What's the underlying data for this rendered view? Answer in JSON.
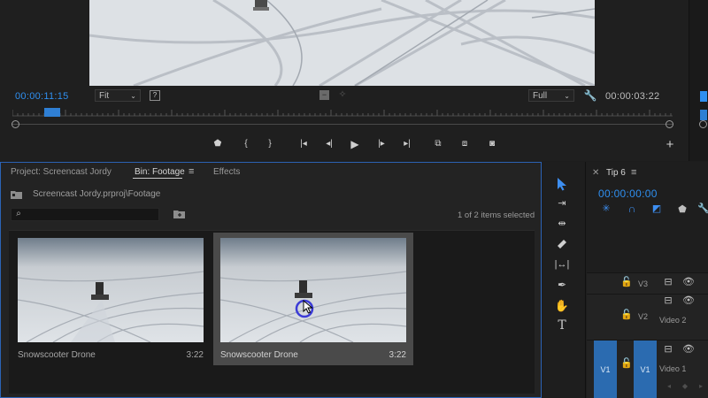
{
  "program_monitor": {
    "current_timecode": "00:00:11:15",
    "fit_select": "Fit",
    "quality_select": "Full",
    "duration_timecode": "00:00:03:22",
    "transport": [
      {
        "name": "add-marker",
        "glyph": "⬟"
      },
      {
        "name": "mark-in",
        "glyph": "{"
      },
      {
        "name": "mark-out",
        "glyph": "}"
      },
      {
        "name": "go-to-in",
        "glyph": "|◂"
      },
      {
        "name": "step-back",
        "glyph": "◂|"
      },
      {
        "name": "play",
        "glyph": "▶"
      },
      {
        "name": "step-forward",
        "glyph": "|▸"
      },
      {
        "name": "go-to-out",
        "glyph": "▸|"
      },
      {
        "name": "insert",
        "glyph": "⧉"
      },
      {
        "name": "overwrite",
        "glyph": "⧈"
      },
      {
        "name": "export-frame",
        "glyph": "◙"
      }
    ],
    "add_button_glyph": "+"
  },
  "project_panel": {
    "tabs": [
      {
        "label": "Project: Screencast Jordy",
        "active": false
      },
      {
        "label": "Bin: Footage",
        "active": true
      },
      {
        "label": "Effects",
        "active": false
      }
    ],
    "tab_menu_glyph": "≡",
    "path": "Screencast Jordy.prproj\\Footage",
    "search_placeholder": "",
    "selection_status": "1 of 2 items selected",
    "items": [
      {
        "name": "Snowscooter Drone",
        "duration": "3:22",
        "selected": false
      },
      {
        "name": "Snowscooter Drone",
        "duration": "3:22",
        "selected": true
      }
    ]
  },
  "tools": [
    "selection-tool",
    "track-select-tool",
    "ripple-edit-tool",
    "razor-tool",
    "slip-tool",
    "pen-tool",
    "hand-tool",
    "type-tool"
  ],
  "timeline": {
    "tab_label": "Tip 6",
    "tab_menu_glyph": "≡",
    "timecode": "00:00:00:00",
    "tracks": [
      {
        "id": "V3",
        "name": ""
      },
      {
        "id": "V2",
        "name": "Video 2"
      },
      {
        "id": "V1",
        "name": "Video 1"
      }
    ],
    "source_patch": "V1"
  },
  "colors": {
    "accent_blue": "#2f8ff0",
    "panel_focus": "#2b63b5",
    "track_target": "#2b6bb0"
  }
}
